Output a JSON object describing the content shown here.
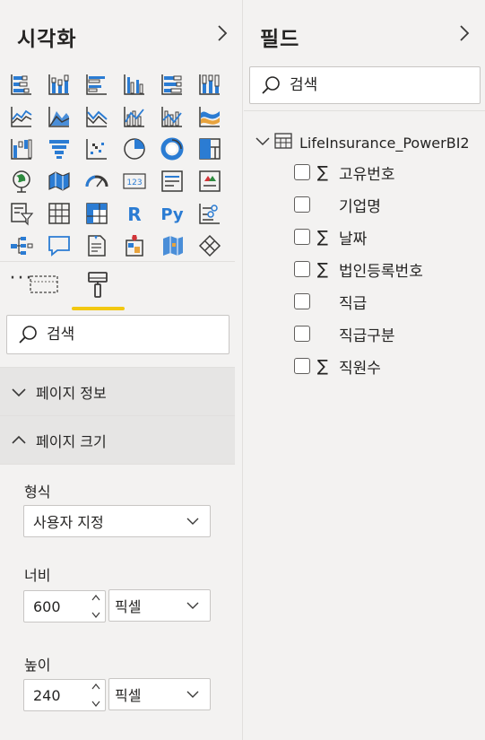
{
  "viz_pane": {
    "title": "시각화",
    "collapse_icon": "chevron-right-icon",
    "viz_icons": [
      "stacked-bar-chart-icon",
      "stacked-column-chart-icon",
      "clustered-bar-chart-icon",
      "clustered-column-chart-icon",
      "100-stacked-bar-chart-icon",
      "100-stacked-column-chart-icon",
      "line-chart-icon",
      "area-chart-icon",
      "stacked-area-chart-icon",
      "line-and-stacked-column-chart-icon",
      "line-and-clustered-column-chart-icon",
      "ribbon-chart-icon",
      "waterfall-chart-icon",
      "funnel-chart-icon",
      "scatter-chart-icon",
      "pie-chart-icon",
      "donut-chart-icon",
      "treemap-icon",
      "map-icon",
      "filled-map-icon",
      "gauge-icon",
      "card-icon",
      "multi-row-card-icon",
      "kpi-icon",
      "slicer-icon",
      "table-icon",
      "matrix-icon",
      "r-script-visual-icon",
      "python-visual-icon",
      "key-influencers-icon",
      "decomposition-tree-icon",
      "qa-icon",
      "smart-narrative-icon",
      "paginated-report-icon",
      "azure-map-icon",
      "power-apps-icon"
    ],
    "r_label": "R",
    "py_label": "Py",
    "more_label": "···",
    "tabs": [
      {
        "name": "fields-well-tab-icon"
      },
      {
        "name": "format-paintbrush-tab-icon",
        "selected": true
      }
    ],
    "search": {
      "placeholder": "검색"
    },
    "sections": [
      {
        "label": "페이지 정보",
        "expanded": false
      },
      {
        "label": "페이지 크기",
        "expanded": true
      }
    ],
    "format": {
      "type_label": "형식",
      "type_value": "사용자 지정",
      "width_label": "너비",
      "width_value": "600",
      "width_unit": "픽셀",
      "height_label": "높이",
      "height_value": "240",
      "height_unit": "픽셀"
    }
  },
  "fields_pane": {
    "title": "필드",
    "collapse_icon": "chevron-right-icon",
    "search": {
      "placeholder": "검색"
    },
    "table": {
      "name": "LifeInsurance_PowerBI2",
      "fields": [
        {
          "name": "고유번호",
          "sigma": true
        },
        {
          "name": "기업명",
          "sigma": false
        },
        {
          "name": "날짜",
          "sigma": true
        },
        {
          "name": "법인등록번호",
          "sigma": true
        },
        {
          "name": "직급",
          "sigma": false
        },
        {
          "name": "직급구분",
          "sigma": false
        },
        {
          "name": "직원수",
          "sigma": true
        }
      ]
    },
    "sigma_symbol": "∑"
  },
  "colors": {
    "accent_yellow": "#f2c811",
    "viz_blue": "#2b7cd3",
    "viz_dark": "#3b3a39",
    "pane_bg": "#f3f2f1",
    "section_bg": "#e6e5e4"
  }
}
